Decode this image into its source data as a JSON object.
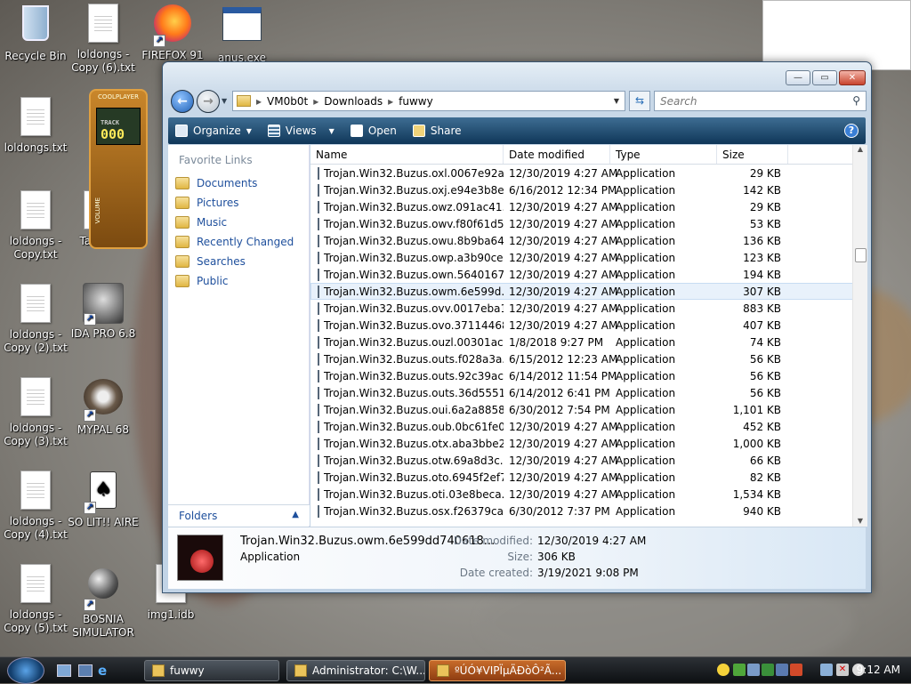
{
  "desktop_icons": [
    {
      "label": "Recycle Bin",
      "type": "bin"
    },
    {
      "label": "loldongs - Copy (6).txt",
      "type": "txt"
    },
    {
      "label": "FIREFOX 91",
      "type": "firefox"
    },
    {
      "label": "anus.exe",
      "type": "exe"
    },
    {
      "label": "loldongs.txt",
      "type": "txt"
    },
    {
      "label": "loldongs - Copy.txt",
      "type": "txt"
    },
    {
      "label": "Taco.png",
      "type": "img"
    },
    {
      "label": "loldongs - Copy (2).txt",
      "type": "txt"
    },
    {
      "label": "IDA PRO 6.8",
      "type": "ida"
    },
    {
      "label": "loldongs - Copy (3).txt",
      "type": "txt"
    },
    {
      "label": "MYPAL 68",
      "type": "mypal"
    },
    {
      "label": "loldongs - Copy (4).txt",
      "type": "txt"
    },
    {
      "label": "SO LIT!! AIRE",
      "type": "cards"
    },
    {
      "label": "loldongs - Copy (5).txt",
      "type": "txt"
    },
    {
      "label": "BOSNIA SIMULATOR",
      "type": "mine"
    },
    {
      "label": "img1.idb",
      "type": "idb"
    }
  ],
  "coolplayer": {
    "title": "COOLPLAYER",
    "track_label": "TRACK",
    "track": "000",
    "volume": "VOLUME"
  },
  "window": {
    "buttons": {
      "minimize": "—",
      "maximize": "▭",
      "close": "✕"
    },
    "breadcrumb": [
      "VM0b0t",
      "Downloads",
      "fuwwy"
    ],
    "search_placeholder": "Search",
    "toolbar": {
      "organize": "Organize",
      "views": "Views",
      "open": "Open",
      "share": "Share",
      "help": "?"
    },
    "nav": {
      "title": "Favorite Links",
      "links": [
        "Documents",
        "Pictures",
        "Music",
        "Recently Changed",
        "Searches",
        "Public"
      ],
      "folders": "Folders"
    },
    "columns": {
      "name": "Name",
      "date": "Date modified",
      "type": "Type",
      "size": "Size"
    },
    "files": [
      {
        "name": "Trojan.Win32.Buzus.oxl.0067e92a...",
        "date": "12/30/2019 4:27 AM",
        "type": "Application",
        "size": "29 KB"
      },
      {
        "name": "Trojan.Win32.Buzus.oxj.e94e3b8e...",
        "date": "6/16/2012 12:34 PM",
        "type": "Application",
        "size": "142 KB"
      },
      {
        "name": "Trojan.Win32.Buzus.owz.091ac41...",
        "date": "12/30/2019 4:27 AM",
        "type": "Application",
        "size": "29 KB"
      },
      {
        "name": "Trojan.Win32.Buzus.owv.f80f61d5...",
        "date": "12/30/2019 4:27 AM",
        "type": "Application",
        "size": "53 KB"
      },
      {
        "name": "Trojan.Win32.Buzus.owu.8b9ba64...",
        "date": "12/30/2019 4:27 AM",
        "type": "Application",
        "size": "136 KB"
      },
      {
        "name": "Trojan.Win32.Buzus.owp.a3b90ce...",
        "date": "12/30/2019 4:27 AM",
        "type": "Application",
        "size": "123 KB"
      },
      {
        "name": "Trojan.Win32.Buzus.own.5640167...",
        "date": "12/30/2019 4:27 AM",
        "type": "Application",
        "size": "194 KB"
      },
      {
        "name": "Trojan.Win32.Buzus.owm.6e599d...",
        "date": "12/30/2019 4:27 AM",
        "type": "Application",
        "size": "307 KB"
      },
      {
        "name": "Trojan.Win32.Buzus.ovv.0017eba1...",
        "date": "12/30/2019 4:27 AM",
        "type": "Application",
        "size": "883 KB"
      },
      {
        "name": "Trojan.Win32.Buzus.ovo.37114468...",
        "date": "12/30/2019 4:27 AM",
        "type": "Application",
        "size": "407 KB"
      },
      {
        "name": "Trojan.Win32.Buzus.ouzl.00301ac...",
        "date": "1/8/2018 9:27 PM",
        "type": "Application",
        "size": "74 KB"
      },
      {
        "name": "Trojan.Win32.Buzus.outs.f028a3a...",
        "date": "6/15/2012 12:23 AM",
        "type": "Application",
        "size": "56 KB"
      },
      {
        "name": "Trojan.Win32.Buzus.outs.92c39ac...",
        "date": "6/14/2012 11:54 PM",
        "type": "Application",
        "size": "56 KB"
      },
      {
        "name": "Trojan.Win32.Buzus.outs.36d5551...",
        "date": "6/14/2012 6:41 PM",
        "type": "Application",
        "size": "56 KB"
      },
      {
        "name": "Trojan.Win32.Buzus.oui.6a2a8858...",
        "date": "6/30/2012 7:54 PM",
        "type": "Application",
        "size": "1,101 KB"
      },
      {
        "name": "Trojan.Win32.Buzus.oub.0bc61fe0...",
        "date": "12/30/2019 4:27 AM",
        "type": "Application",
        "size": "452 KB"
      },
      {
        "name": "Trojan.Win32.Buzus.otx.aba3bbe2...",
        "date": "12/30/2019 4:27 AM",
        "type": "Application",
        "size": "1,000 KB"
      },
      {
        "name": "Trojan.Win32.Buzus.otw.69a8d3c...",
        "date": "12/30/2019 4:27 AM",
        "type": "Application",
        "size": "66 KB"
      },
      {
        "name": "Trojan.Win32.Buzus.oto.6945f2ef7...",
        "date": "12/30/2019 4:27 AM",
        "type": "Application",
        "size": "82 KB"
      },
      {
        "name": "Trojan.Win32.Buzus.oti.03e8beca...",
        "date": "12/30/2019 4:27 AM",
        "type": "Application",
        "size": "1,534 KB"
      },
      {
        "name": "Trojan.Win32.Buzus.osx.f26379ca...",
        "date": "6/30/2012 7:37 PM",
        "type": "Application",
        "size": "940 KB"
      }
    ],
    "selected_index": 7,
    "details": {
      "name": "Trojan.Win32.Buzus.owm.6e599dd740618...",
      "kind": "Application",
      "date_modified_label": "Date modified:",
      "date_modified": "12/30/2019 4:27 AM",
      "size_label": "Size:",
      "size": "306 KB",
      "date_created_label": "Date created:",
      "date_created": "3/19/2021 9:08 PM"
    }
  },
  "taskbar": {
    "tasks": [
      {
        "label": "fuwwy",
        "active": false
      },
      {
        "label": "Administrator: C:\\W...",
        "active": false
      },
      {
        "label": "ºÚÓ¥VIPÏµÄÐòÔ²Ã...",
        "active": true
      }
    ],
    "clock": "9:12 AM"
  },
  "colors": {
    "accent": "#1e4f9c",
    "toolbar": "#1b466c",
    "taskbar": "#1b1f24"
  }
}
